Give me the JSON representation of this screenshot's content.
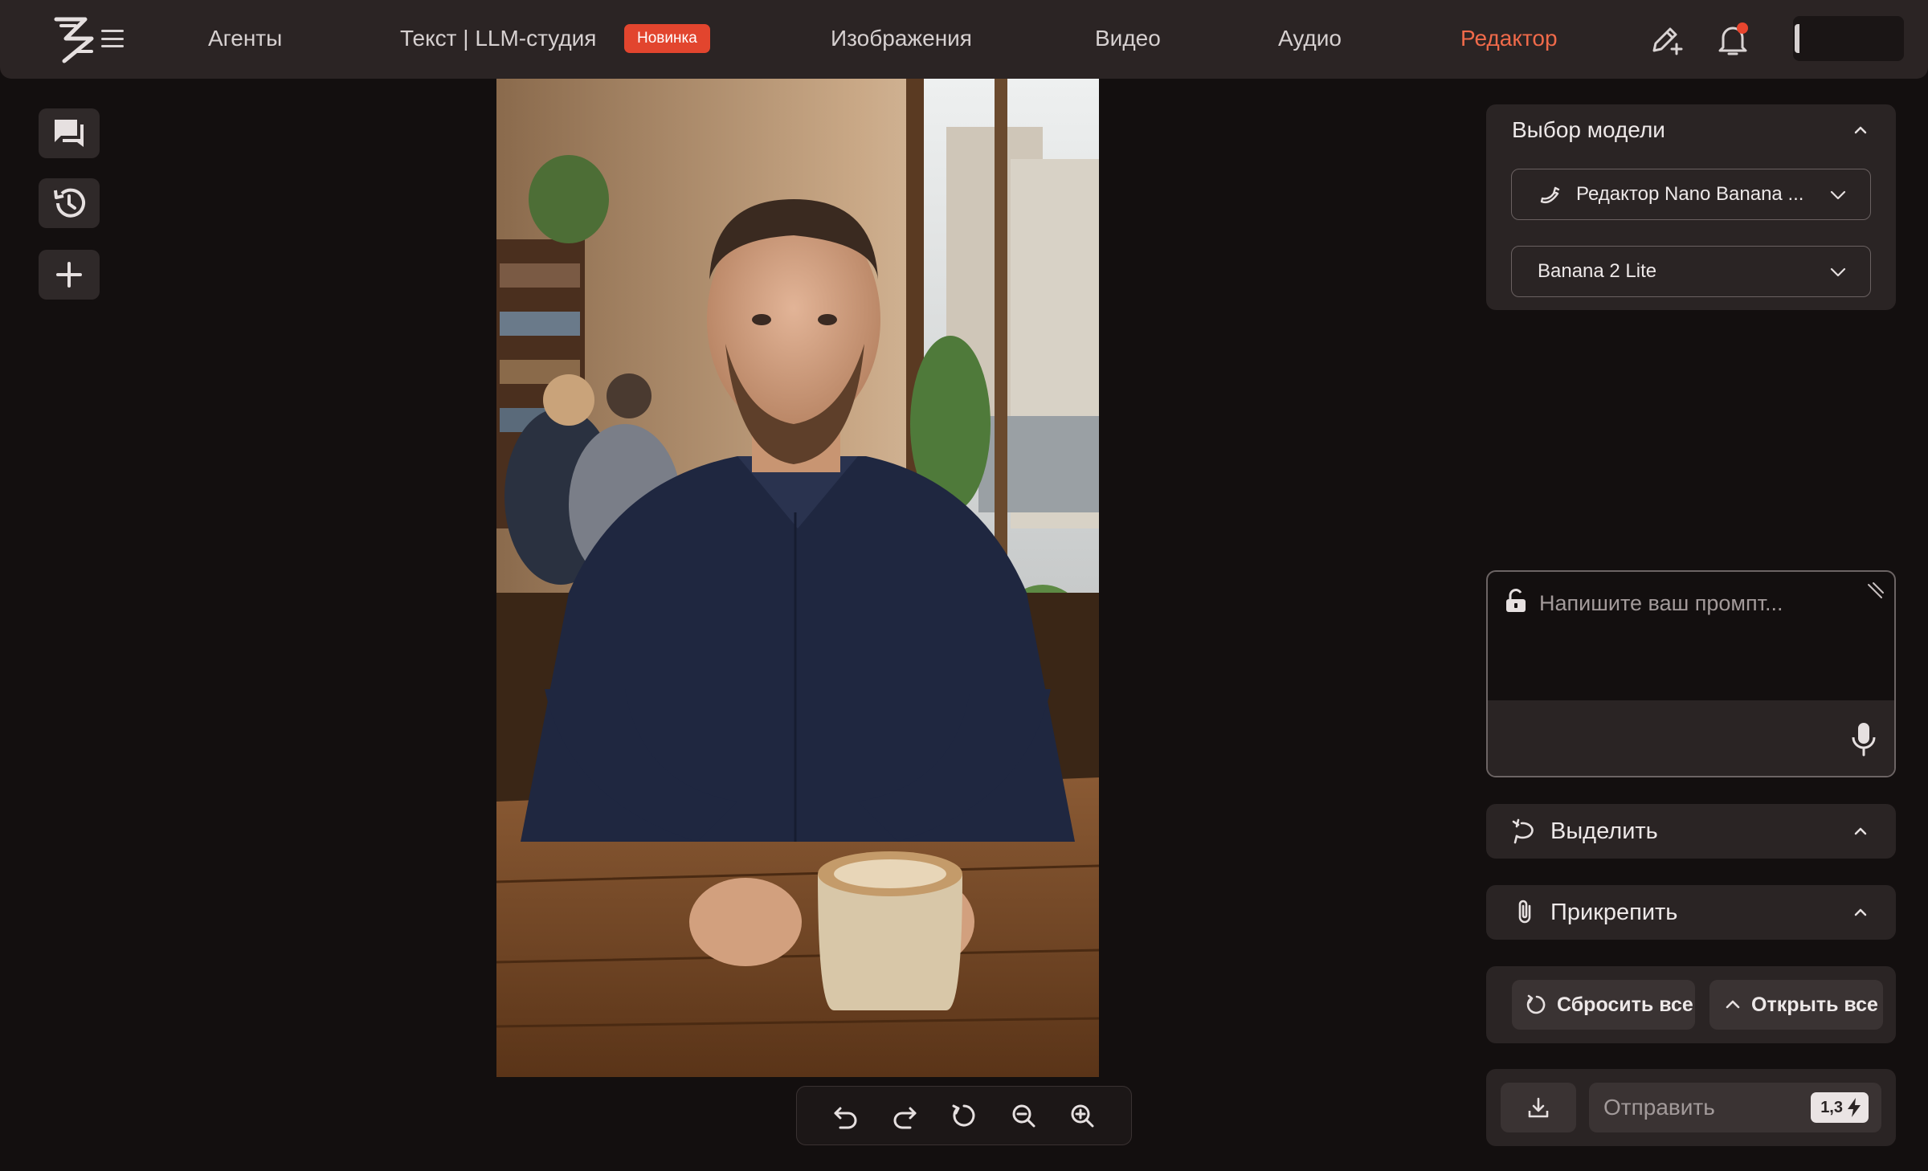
{
  "nav": {
    "items": [
      {
        "label": "Агенты"
      },
      {
        "label": "Текст | LLM-студия"
      },
      {
        "label": "Изображения"
      },
      {
        "label": "Видео"
      },
      {
        "label": "Аудио"
      },
      {
        "label": "Редактор"
      }
    ],
    "new_badge": "Новинка",
    "active_item": "Редактор"
  },
  "colors": {
    "accent": "#f06a4a",
    "badge": "#e2452e",
    "background": "#130f0f",
    "panel": "#2a2424"
  },
  "icons": {
    "edit": "pencil-sparkle-icon",
    "notifications": "bell-icon",
    "sidebar": [
      "chat-icon",
      "history-icon",
      "plus-icon"
    ],
    "toolbar": [
      "undo-icon",
      "redo-icon",
      "reset-icon",
      "zoom-out-icon",
      "zoom-in-icon"
    ]
  },
  "model_panel": {
    "title": "Выбор модели",
    "model_select": "Редактор Nano Banana ...",
    "version_select": "Banana 2 Lite"
  },
  "prompt": {
    "placeholder": "Напишите ваш промпт..."
  },
  "sections": {
    "select": "Выделить",
    "attach": "Прикрепить"
  },
  "actions": {
    "reset_all": "Сбросить все",
    "open_all": "Открыть все"
  },
  "send": {
    "label": "Отправить",
    "cost": "1,3"
  }
}
